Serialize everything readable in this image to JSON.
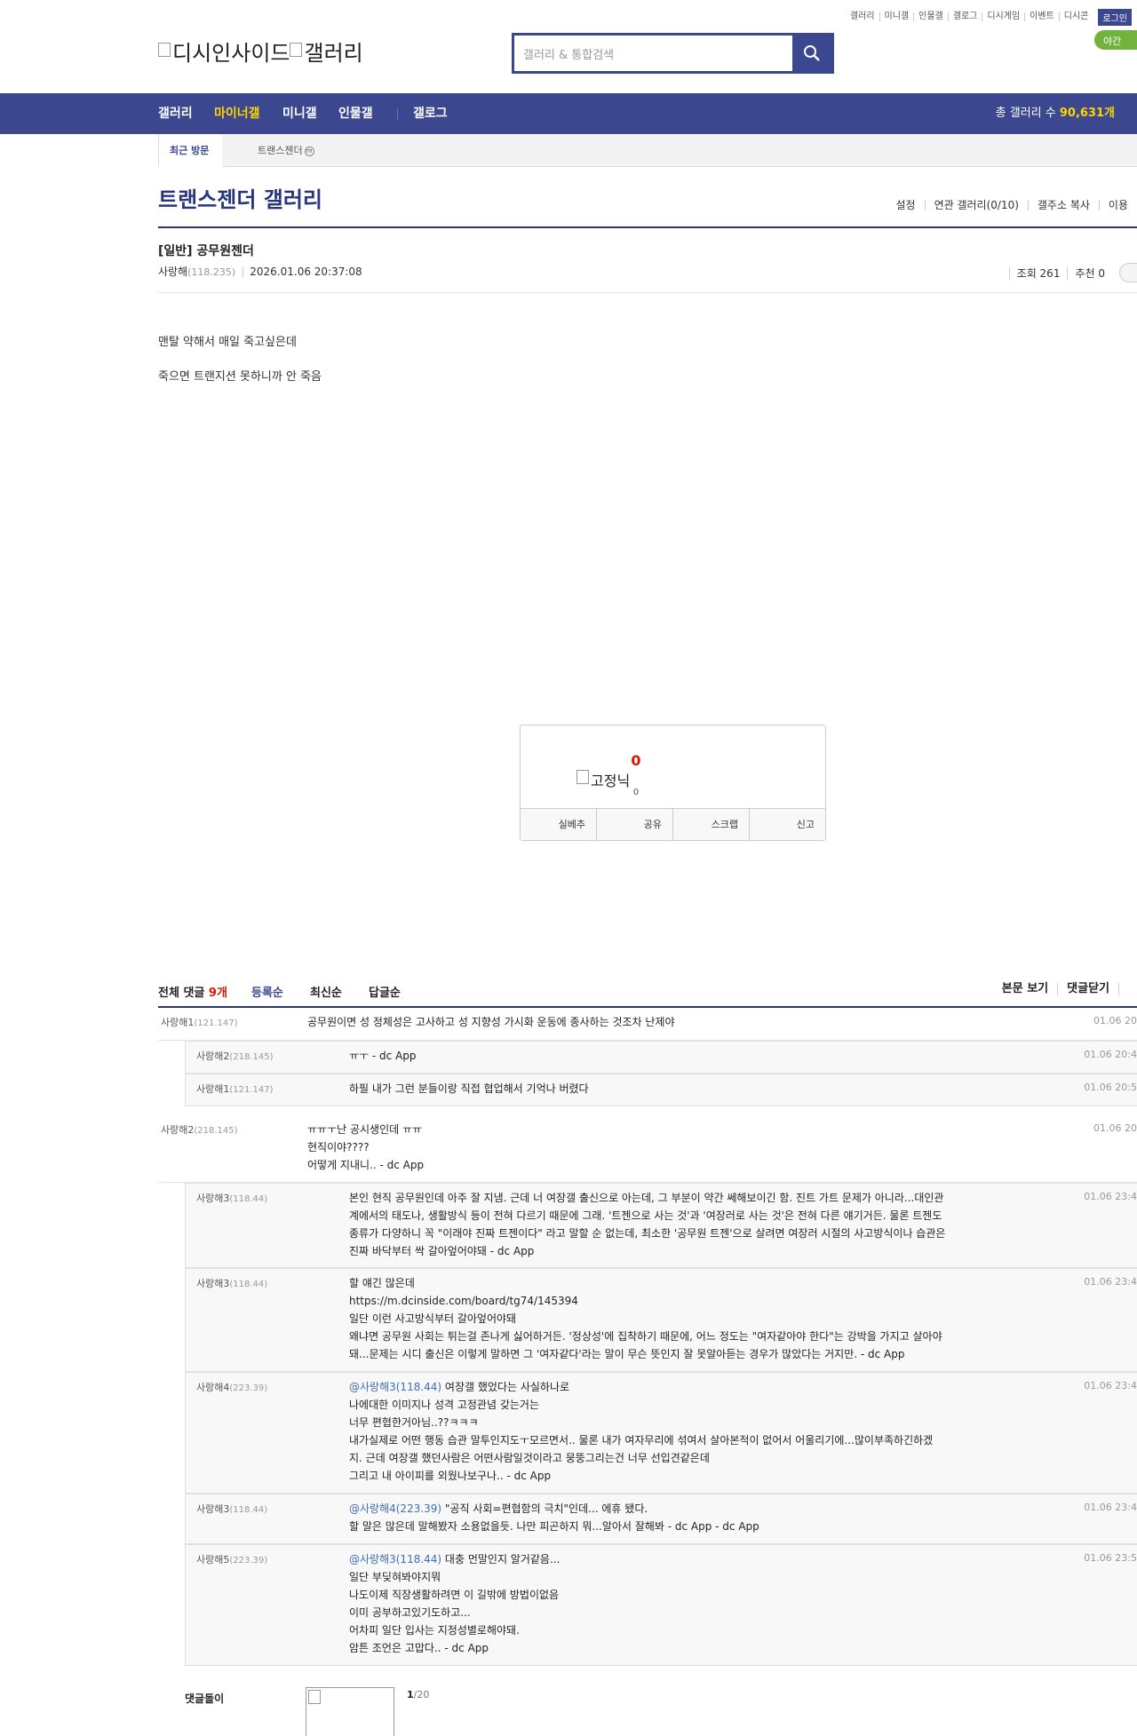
{
  "util": [
    "갤러리",
    "미니갤",
    "인물갤",
    "갤로그",
    "디시게임",
    "이벤트",
    "디시콘"
  ],
  "login": "로그인",
  "night": "야간 모드",
  "logo": {
    "alt1": "디시인사이드",
    "alt2": "갤러리"
  },
  "search": {
    "placeholder": "갤러리 & 통합검색"
  },
  "nav": {
    "items": [
      "갤러리",
      "마이너갤",
      "미니갤",
      "인물갤",
      "갤로그"
    ],
    "total_label": "총 갤러리 수",
    "total_value": "90,631개"
  },
  "sub": {
    "tab": "최근 방문",
    "visited": "트랜스젠더"
  },
  "gallery": {
    "title": "트랜스젠더 갤러리",
    "menu": [
      "설정",
      "연관 갤러리(0/10)",
      "갤주소 복사",
      "이용"
    ]
  },
  "post": {
    "title": "[일반] 공무원젠더",
    "author": "사랑해",
    "ip": "(118.235)",
    "date": "2026.01.06 20:37:08",
    "views": "조회 261",
    "recommend": "추천 0",
    "body": [
      "맨탈 약해서 매일 죽고싶은데",
      "죽으면 트랜지션 못하니까 안 죽음"
    ]
  },
  "rec": {
    "count": "0",
    "fix": "고정닉",
    "fix_count": "0",
    "buttons": [
      "실베추",
      "공유",
      "스크랩",
      "신고"
    ]
  },
  "comments_head": {
    "label": "전체 댓글",
    "count": "9개",
    "orders": [
      "등록순",
      "최신순",
      "답글순"
    ],
    "right": [
      "본문 보기",
      "댓글닫기"
    ]
  },
  "comments": [
    {
      "nick": "사랑해1",
      "ip": "(121.147)",
      "lines": [
        "공무원이면 성 정체성은 고사하고 성 지향성 가시화 운동에 종사하는 것조차 난제야"
      ],
      "date": "01.06 20"
    },
    {
      "nick": "사랑해2",
      "ip": "(218.145)",
      "lines": [
        "ㅠㅜ - dc App"
      ],
      "date": "01.06 20:4"
    },
    {
      "nick": "사랑해1",
      "ip": "(121.147)",
      "lines": [
        "하필 내가 그런 분들이랑 직접 협업해서 기억나 버렸다"
      ],
      "date": "01.06 20:5"
    },
    {
      "nick": "사랑해2",
      "ip": "(218.145)",
      "lines": [
        "ㅠㅠㅜ난 공시생인데 ㅠㅠ",
        "현직이야????",
        "어떻게 지내니.. - dc App"
      ],
      "date": "01.06 20"
    },
    {
      "nick": "사랑해3",
      "ip": "(118.44)",
      "lines": [
        "본인 현직 공무원인데 아주 잘 지냄. 근데 너 여장갤 출신으로 아는데, 그 부분이 약간 쎄해보이긴 함. 진트 가트 문제가 아니라...대인관",
        "계에서의 태도나, 생활방식 등이 전혀 다르기 때문에 그래. '트젠으로 사는 것'과 '여장러로 사는 것'은 전혀 다른 얘기거든. 물론 트젠도",
        "종류가 다양하니 꼭 \"이래야 진짜 트젠이다\" 라고 말할 순 없는데, 최소한 '공무원 트젠'으로 살려면 여장러 시절의 사고방식이나 습관은",
        "진짜 바닥부터 싹 갈아엎어야돼 - dc App"
      ],
      "date": "01.06 23:4"
    },
    {
      "nick": "사랑해3",
      "ip": "(118.44)",
      "lines": [
        "할 얘긴 많은데",
        "https://m.dcinside.com/board/tg74/145394",
        "일단 이런 사고방식부터 갈아엎어야돼",
        "왜냐면 공무원 사회는 튀는걸 존나게 싫어하거든. '정상성'에 집착하기 때문에, 어느 정도는 \"여자같아야 한다\"는 강박을 가지고 살아야",
        "돼...문제는 시디 출신은 이렇게 말하면 그 '여자같다'라는 말이 무슨 뜻인지 잘 못알아듣는 경우가 많았다는 거지만. - dc App"
      ],
      "date": "01.06 23:4"
    },
    {
      "nick": "사랑해4",
      "ip": "(223.39)",
      "at": "@사랑해3(118.44)",
      "lines": [
        " 여장갤 했었다는 사실하나로",
        "나에대한 이미지나 성격 고정관념 갖는거는",
        "너무 편협한거아님..??ㅋㅋㅋ",
        "내가실제로 어떤 행동 습관 말투인지도ㅜ모르면서.. 물론 내가 여자무리에 섞여서 살아본적이 없어서 어울리기에...많이부족하긴하겠",
        "지. 근데 여장갤 했던사람은 어떤사람일것이라고 뭉뚱그리는건 너무 선입견같은데",
        "그리고 내 아이피를 외웠나보구나.. - dc App"
      ],
      "date": "01.06 23:4"
    },
    {
      "nick": "사랑해3",
      "ip": "(118.44)",
      "at": "@사랑해4(223.39)",
      "lines": [
        " \"공직 사회=편협함의 극치\"인데... 에휴 됐다.",
        "할 말은 많은데 말해봤자 소용없을듯. 나만 피곤하지 뭐...알아서 잘해봐 - dc App - dc App"
      ],
      "date": "01.06 23:4"
    },
    {
      "nick": "사랑해5",
      "ip": "(223.39)",
      "at": "@사랑해3(118.44)",
      "lines": [
        " 대충 먼말인지 알거같음...",
        "일단 부딪혀봐야지뭐",
        "나도이제 직장생활하려면 이 길밖에 방법이없음",
        "이미 공부하고있기도하고...",
        "어차피 일단 입사는 지정성별로해야돼.",
        "암튼 조언은 고맙다.. - dc App"
      ],
      "date": "01.06 23:5"
    }
  ],
  "reply": {
    "label": "댓글돌이",
    "page": "1",
    "total": "/20"
  }
}
